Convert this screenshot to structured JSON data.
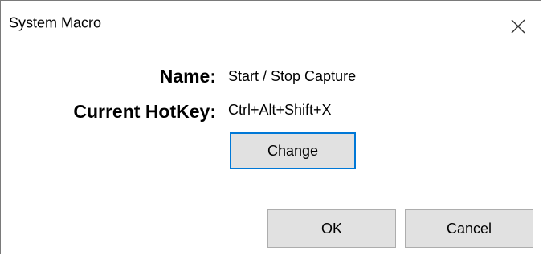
{
  "window": {
    "title": "System Macro",
    "close_icon": "close-icon"
  },
  "fields": {
    "name_label": "Name:",
    "name_value": "Start / Stop Capture",
    "hotkey_label": "Current HotKey:",
    "hotkey_value": "Ctrl+Alt+Shift+X"
  },
  "buttons": {
    "change": "Change",
    "ok": "OK",
    "cancel": "Cancel"
  },
  "colors": {
    "focus_border": "#0078d7",
    "button_face": "#e1e1e1",
    "button_border": "#adadad"
  }
}
